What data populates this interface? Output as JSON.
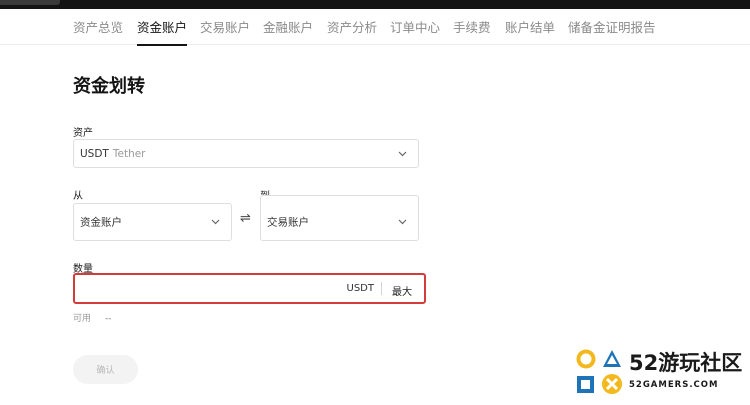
{
  "nav": {
    "tabs": [
      {
        "label": "资产总览"
      },
      {
        "label": "资金账户"
      },
      {
        "label": "交易账户"
      },
      {
        "label": "金融账户"
      },
      {
        "label": "资产分析"
      },
      {
        "label": "订单中心"
      },
      {
        "label": "手续费"
      },
      {
        "label": "账户结单"
      },
      {
        "label": "储备金证明报告"
      }
    ],
    "active_index": 1
  },
  "page_title": "资金划转",
  "asset": {
    "label": "资产",
    "symbol": "USDT",
    "name": "Tether"
  },
  "transfer": {
    "from_label": "从",
    "from_value": "资金账户",
    "to_label": "到",
    "to_value": "交易账户",
    "swap_glyph": "⇌"
  },
  "amount": {
    "label": "数量",
    "value": "",
    "unit": "USDT",
    "max_label": "最大"
  },
  "available": {
    "label": "可用",
    "value": "--"
  },
  "confirm_label": "确认",
  "watermark": {
    "big": "52游玩社区",
    "small": "52GAMERS.COM"
  },
  "colors": {
    "highlight_border": "#d43c3c",
    "watermark_yellow": "#f2b81d",
    "watermark_blue": "#1f74b8"
  }
}
